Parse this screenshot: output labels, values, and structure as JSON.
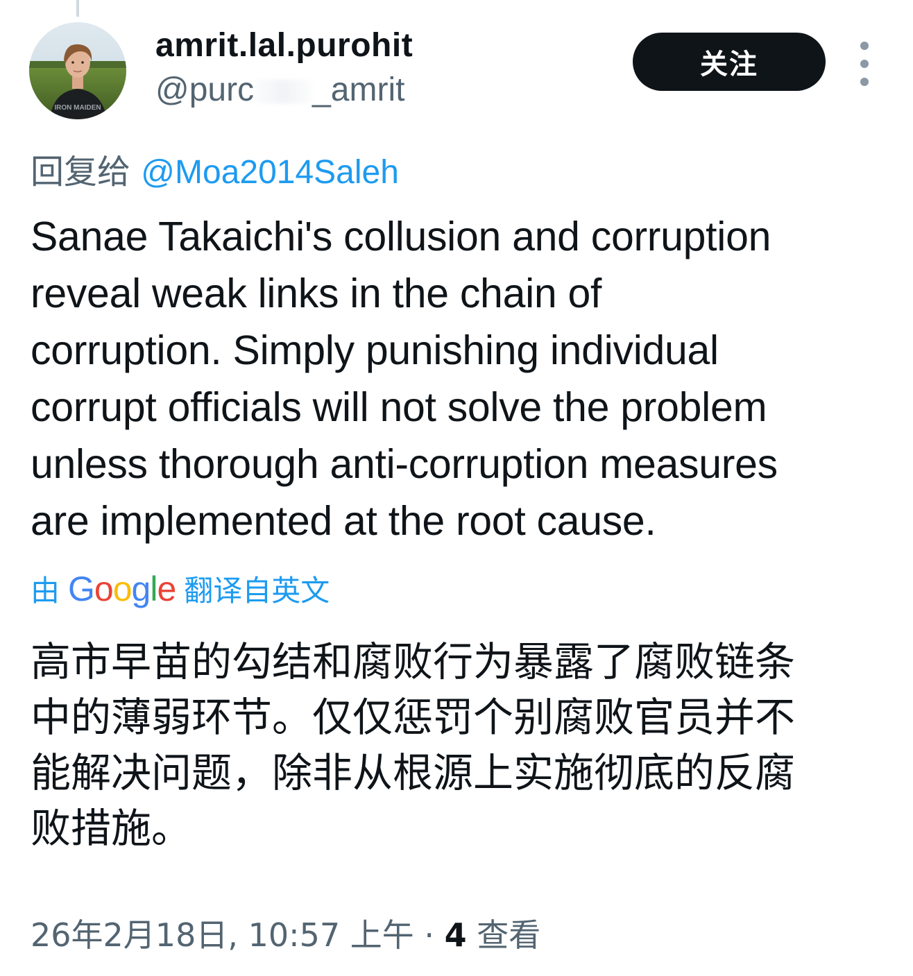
{
  "author": {
    "display_name": "amrit.lal.purohit",
    "handle_start": "@purc",
    "handle_end": "_amrit",
    "follow_label": "关注"
  },
  "reply": {
    "prefix": "回复给",
    "mention": "@Moa2014Saleh"
  },
  "tweet": {
    "lines": [
      "Sanae Takaichi's collusion and corruption",
      "reveal weak links in the chain of",
      "corruption. Simply punishing individual",
      "corrupt officials will not solve the problem",
      "unless thorough anti-corruption measures",
      "are implemented at the root cause."
    ]
  },
  "translation": {
    "prefix": "由",
    "brand": "Google",
    "suffix": "翻译自英文",
    "lines": [
      "高市早苗的勾结和腐败行为暴露了腐败链条",
      "中的薄弱环节。仅仅惩罚个别腐败官员并不",
      "能解决问题，除非从根源上实施彻底的反腐",
      "败措施。"
    ]
  },
  "meta": {
    "timestamp": "26年2月18日, 10:57 上午",
    "separator": " · ",
    "views_count": "4",
    "views_label": " 查看"
  },
  "colors": {
    "text": "#0f1419",
    "secondary": "#536471",
    "link": "#1d9bf0",
    "button_bg": "#0f1419"
  },
  "icons": {
    "more": "more-vertical-icon",
    "avatar": "avatar-photo"
  }
}
